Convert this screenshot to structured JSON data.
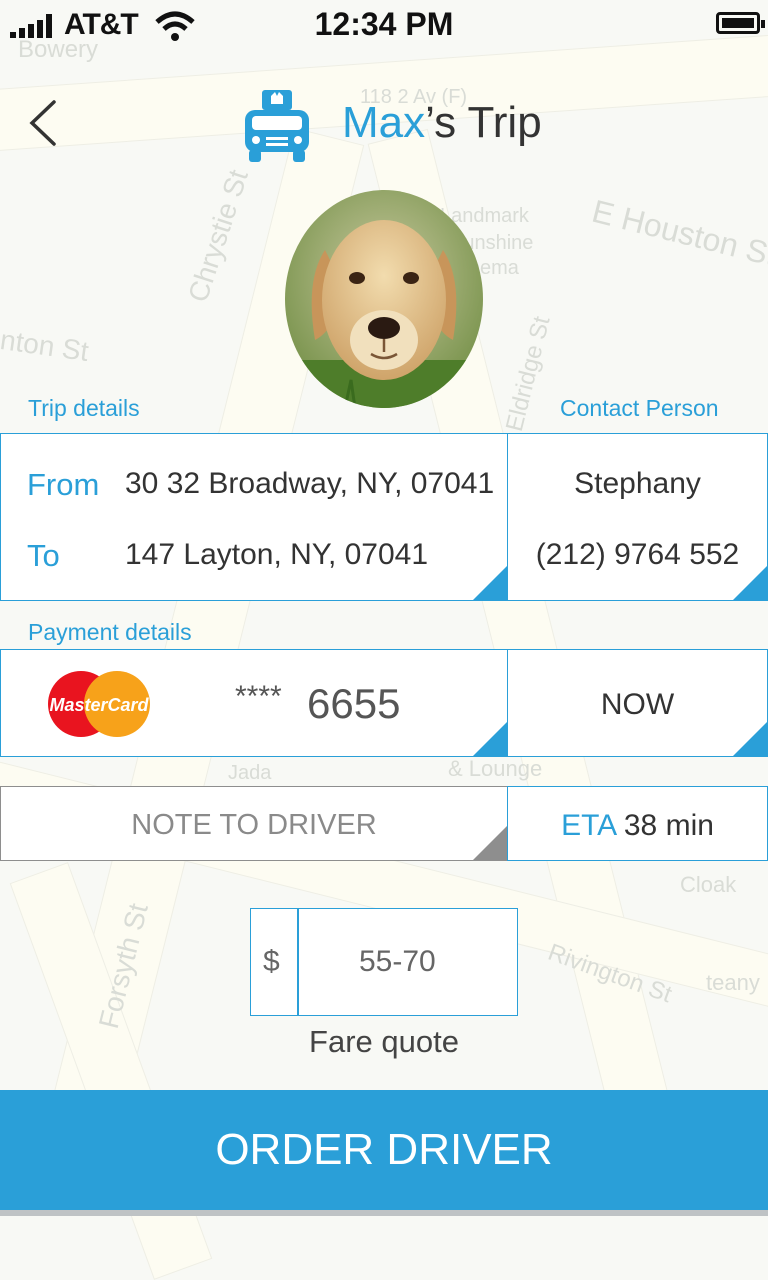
{
  "status_bar": {
    "carrier": "AT&T",
    "time": "12:34 PM"
  },
  "header": {
    "title_name": "Max",
    "title_suffix": "’s Trip"
  },
  "map_labels": [
    "Bowery",
    "Chrystie St",
    "E Houston St",
    "Eldridge St",
    "nton St",
    "Forsyth St",
    "Rivington St",
    "Cloak",
    "teany",
    "Jada",
    "& Lounge",
    "Landmark",
    "Sunshine",
    "Cinema",
    "118 2 Av (F)"
  ],
  "trip": {
    "section_label": "Trip details",
    "from_label": "From",
    "from_value": "30 32 Broadway, NY, 07041",
    "to_label": "To",
    "to_value": "147 Layton, NY, 07041"
  },
  "contact": {
    "section_label": "Contact Person",
    "name": "Stephany",
    "phone": "(212) 9764 552"
  },
  "payment": {
    "section_label": "Payment details",
    "card_brand": "MasterCard",
    "card_mask": "****",
    "card_last4": "6655",
    "timing": "NOW"
  },
  "note": {
    "placeholder": "NOTE TO DRIVER"
  },
  "eta": {
    "label": "ETA",
    "value": "38 min"
  },
  "fare": {
    "currency": "$",
    "range": "55-70",
    "caption": "Fare quote"
  },
  "order_button": "ORDER DRIVER",
  "colors": {
    "accent": "#2a9fd8",
    "mastercard_red": "#e9141f",
    "mastercard_orange": "#f7a21a"
  },
  "icons": [
    "back-chevron-icon",
    "taxi-icon",
    "signal-icon",
    "wifi-icon",
    "battery-icon",
    "mastercard-logo"
  ]
}
